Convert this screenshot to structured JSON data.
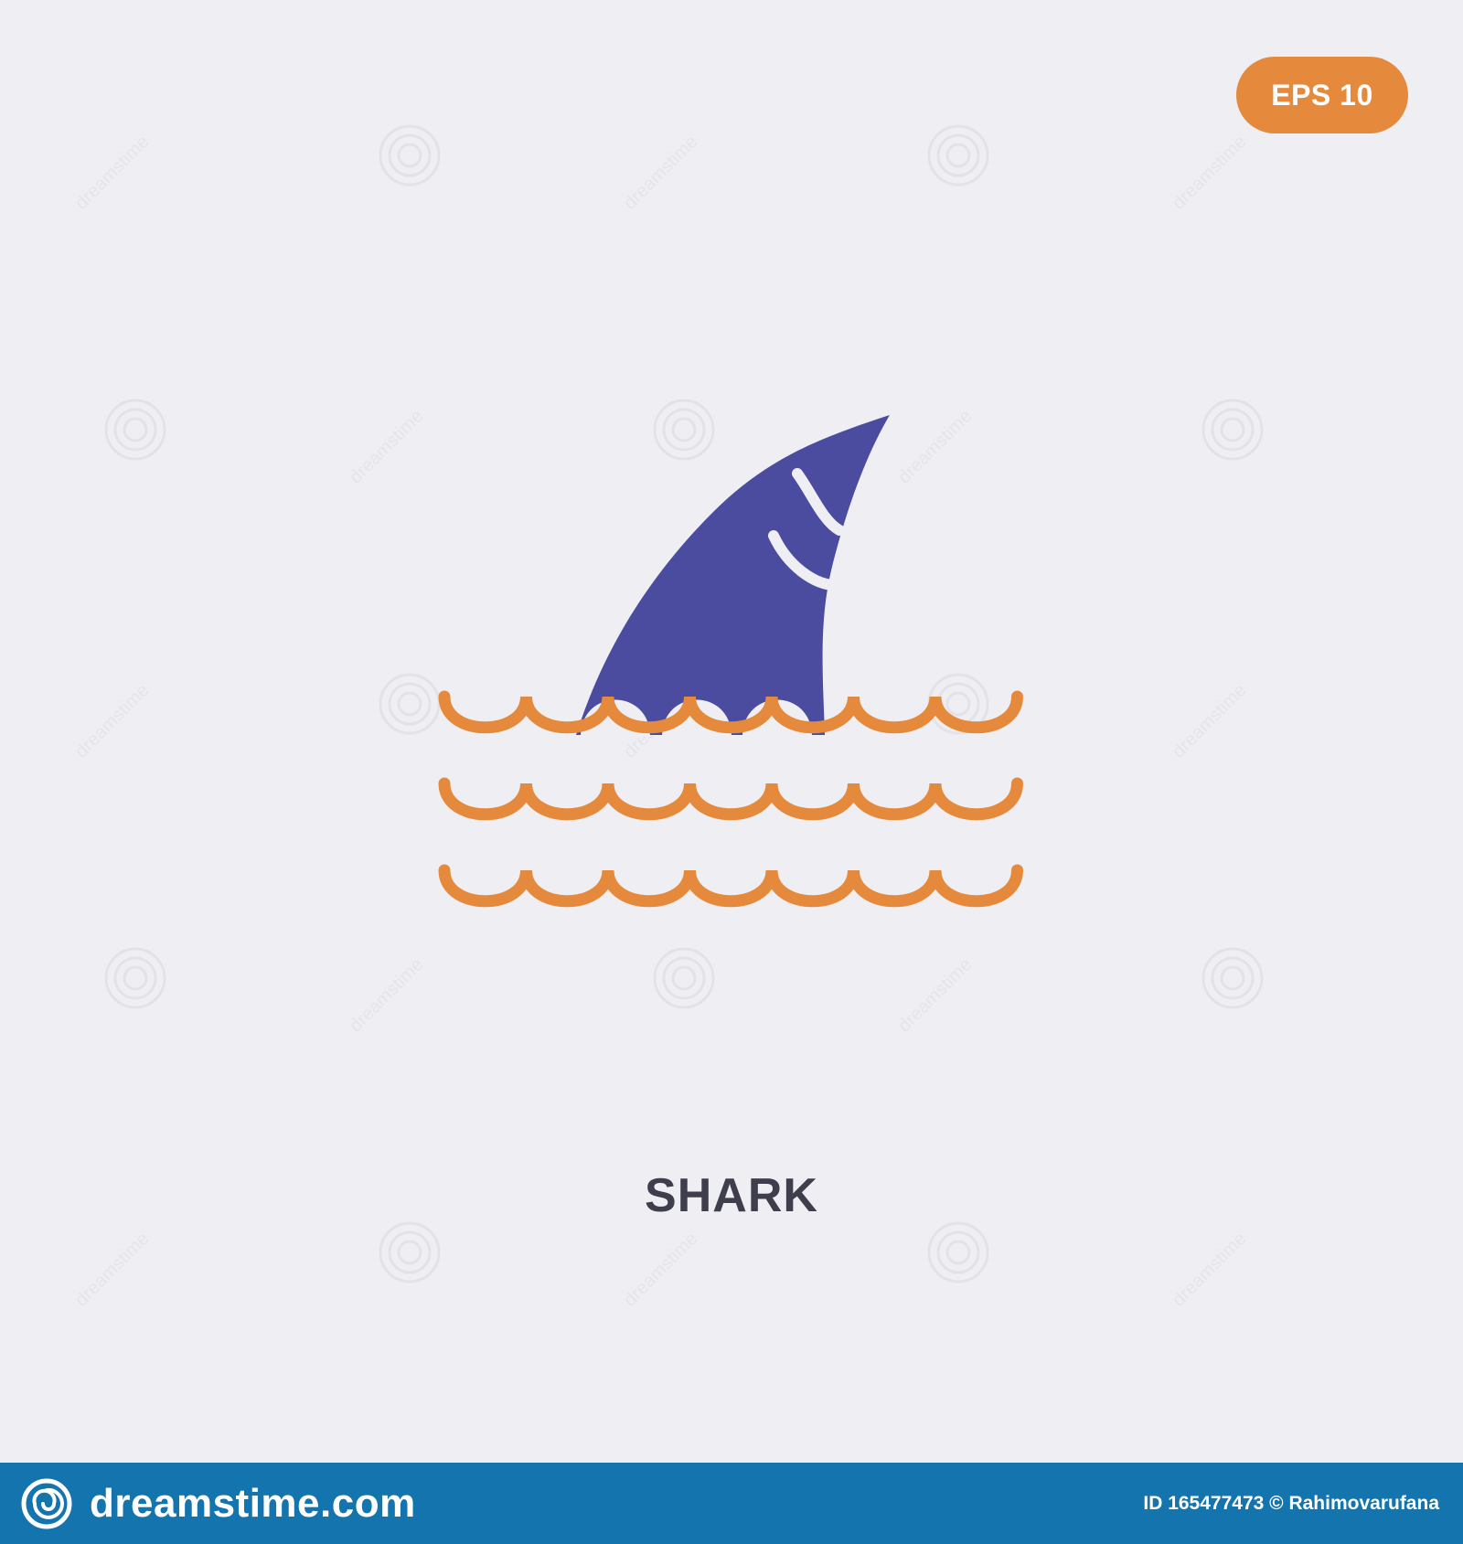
{
  "badge": {
    "label": "EPS 10",
    "color": "#e58a3c"
  },
  "icon": {
    "name": "shark-fin-waves-icon",
    "fin_color": "#4b4c9f",
    "wave_color": "#e58a3c"
  },
  "caption": "SHARK",
  "watermark": {
    "text": "dreamstime"
  },
  "footer": {
    "background": "#1474ad",
    "brand": "dreamstime.com",
    "logo_icon": "dreamstime-spiral-icon",
    "credit": "ID 165477473 © Rahimovarufana"
  }
}
